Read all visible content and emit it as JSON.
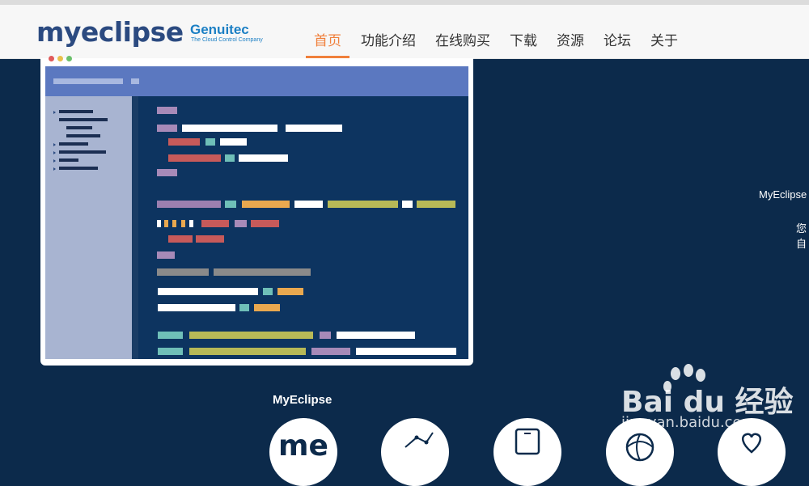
{
  "header": {
    "logo": "myeclipse",
    "company": "Genuitec",
    "company_tagline": "The Cloud Control Company",
    "nav": [
      "首页",
      "功能介绍",
      "在线购买",
      "下载",
      "资源",
      "论坛",
      "关于"
    ],
    "active_index": 0,
    "accent_color": "#f0803c"
  },
  "hero": {
    "side_text_1": "MyEclipse",
    "side_text_2": "您自"
  },
  "section": {
    "title": "MyEclipse",
    "features": [
      {
        "icon": "me-logo-icon",
        "label": "me"
      },
      {
        "icon": "chart-icon"
      },
      {
        "icon": "tablet-icon"
      },
      {
        "icon": "globe-icon"
      },
      {
        "icon": "heart-icon"
      }
    ]
  },
  "watermark": {
    "line1": "Bai du 经验",
    "line2": "jingyan.baidu.com"
  },
  "colors": {
    "background": "#0c2a4b",
    "header": "#f7f7f7",
    "editor_top": "#5b78c0",
    "editor_side": "#a8b4d1",
    "editor_code": "#0d3460"
  }
}
